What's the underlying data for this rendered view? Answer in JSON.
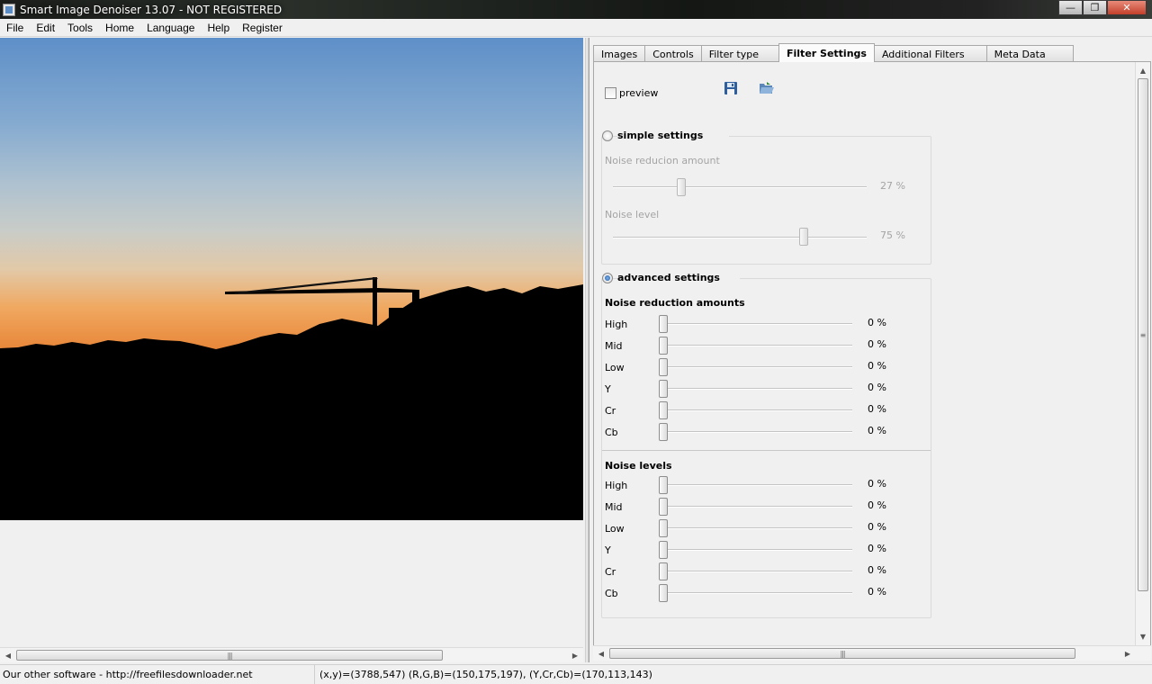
{
  "window": {
    "title": "Smart Image Denoiser 13.07 - NOT REGISTERED",
    "minimize_glyph": "—",
    "maximize_glyph": "❐",
    "close_glyph": "✕"
  },
  "menu": [
    "File",
    "Edit",
    "Tools",
    "Home",
    "Language",
    "Help",
    "Register"
  ],
  "image_scroll": {
    "left_glyph": "◀",
    "right_glyph": "▶",
    "grip": "|||"
  },
  "tabs": [
    "Images",
    "Controls",
    "Filter type",
    "Filter Settings",
    "Additional Filters",
    "Meta Data"
  ],
  "active_tab": "Filter Settings",
  "filter_settings": {
    "preview_label": "preview",
    "preview_checked": false,
    "save_icon": "save-icon",
    "open_icon": "open-folder-icon",
    "simple": {
      "label": "simple settings",
      "selected": false,
      "noise_reduction_label": "Noise reducion amount",
      "noise_reduction_value": 27,
      "noise_reduction_text": "27 %",
      "noise_level_label": "Noise level",
      "noise_level_value": 75,
      "noise_level_text": "75 %"
    },
    "advanced": {
      "label": "advanced settings",
      "selected": true,
      "reduction_title": "Noise reduction amounts",
      "reduction_rows": [
        {
          "label": "High",
          "value": 0,
          "text": "0 %"
        },
        {
          "label": "Mid",
          "value": 0,
          "text": "0 %"
        },
        {
          "label": "Low",
          "value": 0,
          "text": "0 %"
        },
        {
          "label": "Y",
          "value": 0,
          "text": "0 %"
        },
        {
          "label": "Cr",
          "value": 0,
          "text": "0 %"
        },
        {
          "label": "Cb",
          "value": 0,
          "text": "0 %"
        }
      ],
      "levels_title": "Noise levels",
      "level_rows": [
        {
          "label": "High",
          "value": 0,
          "text": "0 %"
        },
        {
          "label": "Mid",
          "value": 0,
          "text": "0 %"
        },
        {
          "label": "Low",
          "value": 0,
          "text": "0 %"
        },
        {
          "label": "Y",
          "value": 0,
          "text": "0 %"
        },
        {
          "label": "Cr",
          "value": 0,
          "text": "0 %"
        },
        {
          "label": "Cb",
          "value": 0,
          "text": "0 %"
        }
      ]
    }
  },
  "panel_scroll": {
    "up_glyph": "▲",
    "down_glyph": "▼",
    "left_glyph": "◀",
    "right_glyph": "▶",
    "grip": "|||",
    "vgrip": "≡"
  },
  "status": {
    "left": "Our other software - http://freefilesdownloader.net",
    "right": "(x,y)=(3788,547) (R,G,B)=(150,175,197), (Y,Cr,Cb)=(170,113,143)"
  }
}
